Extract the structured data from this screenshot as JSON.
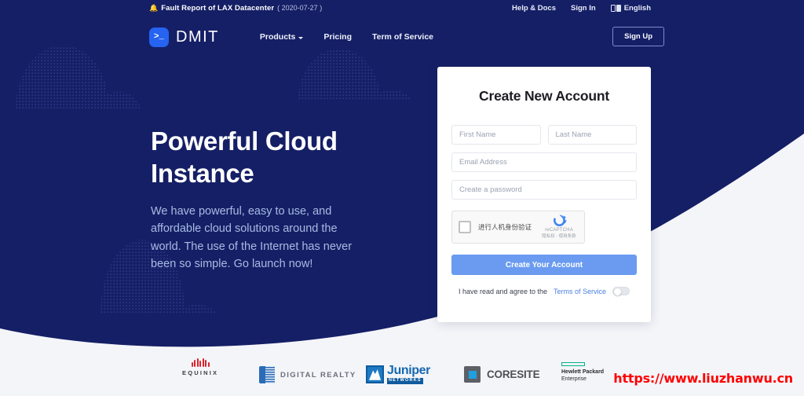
{
  "announcement": {
    "icon": "bell-icon",
    "text": "Fault Report of LAX Datacenter",
    "date": "( 2020-07-27 )"
  },
  "topnav": {
    "help": "Help & Docs",
    "signin": "Sign In",
    "language": "English",
    "language_icon": "translate-icon"
  },
  "brand": {
    "logo_glyph": ">_",
    "name": "DMIT"
  },
  "mainnav": {
    "items": [
      {
        "label": "Products",
        "has_caret": true
      },
      {
        "label": "Pricing",
        "has_caret": false
      },
      {
        "label": "Term of Service",
        "has_caret": false
      }
    ],
    "signup_label": "Sign Up"
  },
  "hero": {
    "title_line1": "Powerful Cloud",
    "title_line2": "Instance",
    "subtitle": "We have powerful, easy to use, and affordable cloud solutions around the world. The use of the Internet has never been so simple. Go launch now!"
  },
  "signup_card": {
    "title": "Create New Account",
    "first_name_placeholder": "First Name",
    "last_name_placeholder": "Last Name",
    "email_placeholder": "Email Address",
    "password_placeholder": "Create a password",
    "first_name_value": "",
    "last_name_value": "",
    "email_value": "",
    "password_value": "",
    "captcha": {
      "label": "进行人机身份验证",
      "brand": "reCAPTCHA",
      "terms": "隐私权 - 使用条款"
    },
    "submit_label": "Create Your Account",
    "terms_prefix": "I have read and agree to the",
    "terms_link": "Terms of Service",
    "toggle_state": "off"
  },
  "partners": [
    {
      "name": "EQUINIX",
      "mark": "equinix-icon"
    },
    {
      "name": "DIGITAL REALTY",
      "mark": "digital-realty-icon"
    },
    {
      "name": "Juniper",
      "sub": "NETWORKS",
      "mark": "juniper-icon"
    },
    {
      "name": "CORESITE",
      "mark": "coresite-icon"
    },
    {
      "name": "Hewlett Packard",
      "sub": "Enterprise",
      "mark": "hpe-icon"
    }
  ],
  "watermark": "https://www.liuzhanwu.cn",
  "colors": {
    "navy": "#151f66",
    "accent_blue": "#6a9bf0",
    "logo_blue": "#2563f0",
    "page_bg": "#f4f5f9",
    "watermark_red": "#ff0000",
    "link_blue": "#4a7fe0"
  }
}
